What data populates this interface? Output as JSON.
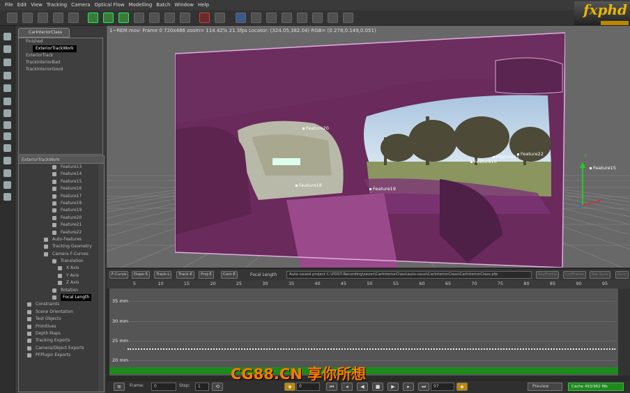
{
  "menu": [
    "File",
    "Edit",
    "View",
    "Tracking",
    "Camera",
    "Optical Flow",
    "Modelling",
    "Batch",
    "Window",
    "Help"
  ],
  "logo_text": "fxphd",
  "tree": {
    "tab_label": "CarInteriorClass",
    "items": [
      "Finished",
      "ExteriorTrackWork",
      "ExteriorTrack",
      "TrackInteriorBad",
      "TrackInteriorGood"
    ],
    "selected_index": 1
  },
  "lower_tree": {
    "tab_label": "ExteriorTrackWork",
    "rows": [
      {
        "label": "Feature13",
        "indent": 60
      },
      {
        "label": "Feature14",
        "indent": 60
      },
      {
        "label": "Feature15",
        "indent": 60
      },
      {
        "label": "Feature16",
        "indent": 60
      },
      {
        "label": "Feature17",
        "indent": 60
      },
      {
        "label": "Feature18",
        "indent": 60
      },
      {
        "label": "Feature19",
        "indent": 60
      },
      {
        "label": "Feature20",
        "indent": 60
      },
      {
        "label": "Feature21",
        "indent": 60
      },
      {
        "label": "Feature22",
        "indent": 60
      },
      {
        "label": "Auto-Features",
        "indent": 48
      },
      {
        "label": "Tracking Geometry",
        "indent": 48
      },
      {
        "label": "Camera F-Curves",
        "indent": 48
      },
      {
        "label": "Translation",
        "indent": 60
      },
      {
        "label": "X Axis",
        "indent": 68
      },
      {
        "label": "Y Axis",
        "indent": 68
      },
      {
        "label": "Z Axis",
        "indent": 68
      },
      {
        "label": "Rotation",
        "indent": 60
      },
      {
        "label": "Focal Length",
        "indent": 60,
        "selected": true
      },
      {
        "label": "Constraints",
        "indent": 24
      },
      {
        "label": "Scene Orientation",
        "indent": 24
      },
      {
        "label": "Test Objects",
        "indent": 24
      },
      {
        "label": "Primitives",
        "indent": 24
      },
      {
        "label": "Depth Maps",
        "indent": 24
      },
      {
        "label": "Tracking Exports",
        "indent": 24
      },
      {
        "label": "Camera/Object Exports",
        "indent": 24
      },
      {
        "label": "PFPlugin Exports",
        "indent": 24
      }
    ]
  },
  "viewport": {
    "label": "1~REM.mov: Frame 0 720x486 zoom= 114.42% 21.3fps Locator: (324.05,382.04) RGB= (0.278,0.149,0.051)",
    "features": [
      {
        "name": "Feature20"
      },
      {
        "name": "Feature18"
      },
      {
        "name": "Feature19"
      },
      {
        "name": "Feature16"
      },
      {
        "name": "Feature21"
      },
      {
        "name": "Feature22"
      },
      {
        "name": "Feature15"
      }
    ],
    "axis_label": "Y"
  },
  "curve_toolbar": {
    "buttons": [
      "F-Curve",
      "Dope-S",
      "Track-L",
      "Track-E",
      "Proj-E",
      "Cam-E"
    ],
    "focal_label": "Focal Length",
    "project_path": "Auto-saved project C:\\POST-Recording\\saver\\CarInteriorClass\\auto-save\\CarInteriorClass\\CarInteriorClass.pfp",
    "right_buttons": [
      "KeyFrame",
      "CutFrame",
      "Set Sync",
      "Sync"
    ]
  },
  "ruler_ticks": [
    "5",
    "10",
    "15",
    "20",
    "25",
    "30",
    "35",
    "40",
    "45",
    "50",
    "55",
    "60",
    "65",
    "70",
    "75",
    "80",
    "85",
    "90",
    "95"
  ],
  "graph_labels": [
    "35 mm",
    "30 mm",
    "25 mm",
    "20 mm"
  ],
  "bottom": {
    "frame_label": "Frame:",
    "frame_value": "0",
    "step_label": "Step:",
    "step_value": "1",
    "start_value": "0",
    "end_value": "97",
    "preview": "Preview",
    "cache": "Cache 493/962 Mb"
  },
  "watermark": "CG88.CN 享你所想"
}
